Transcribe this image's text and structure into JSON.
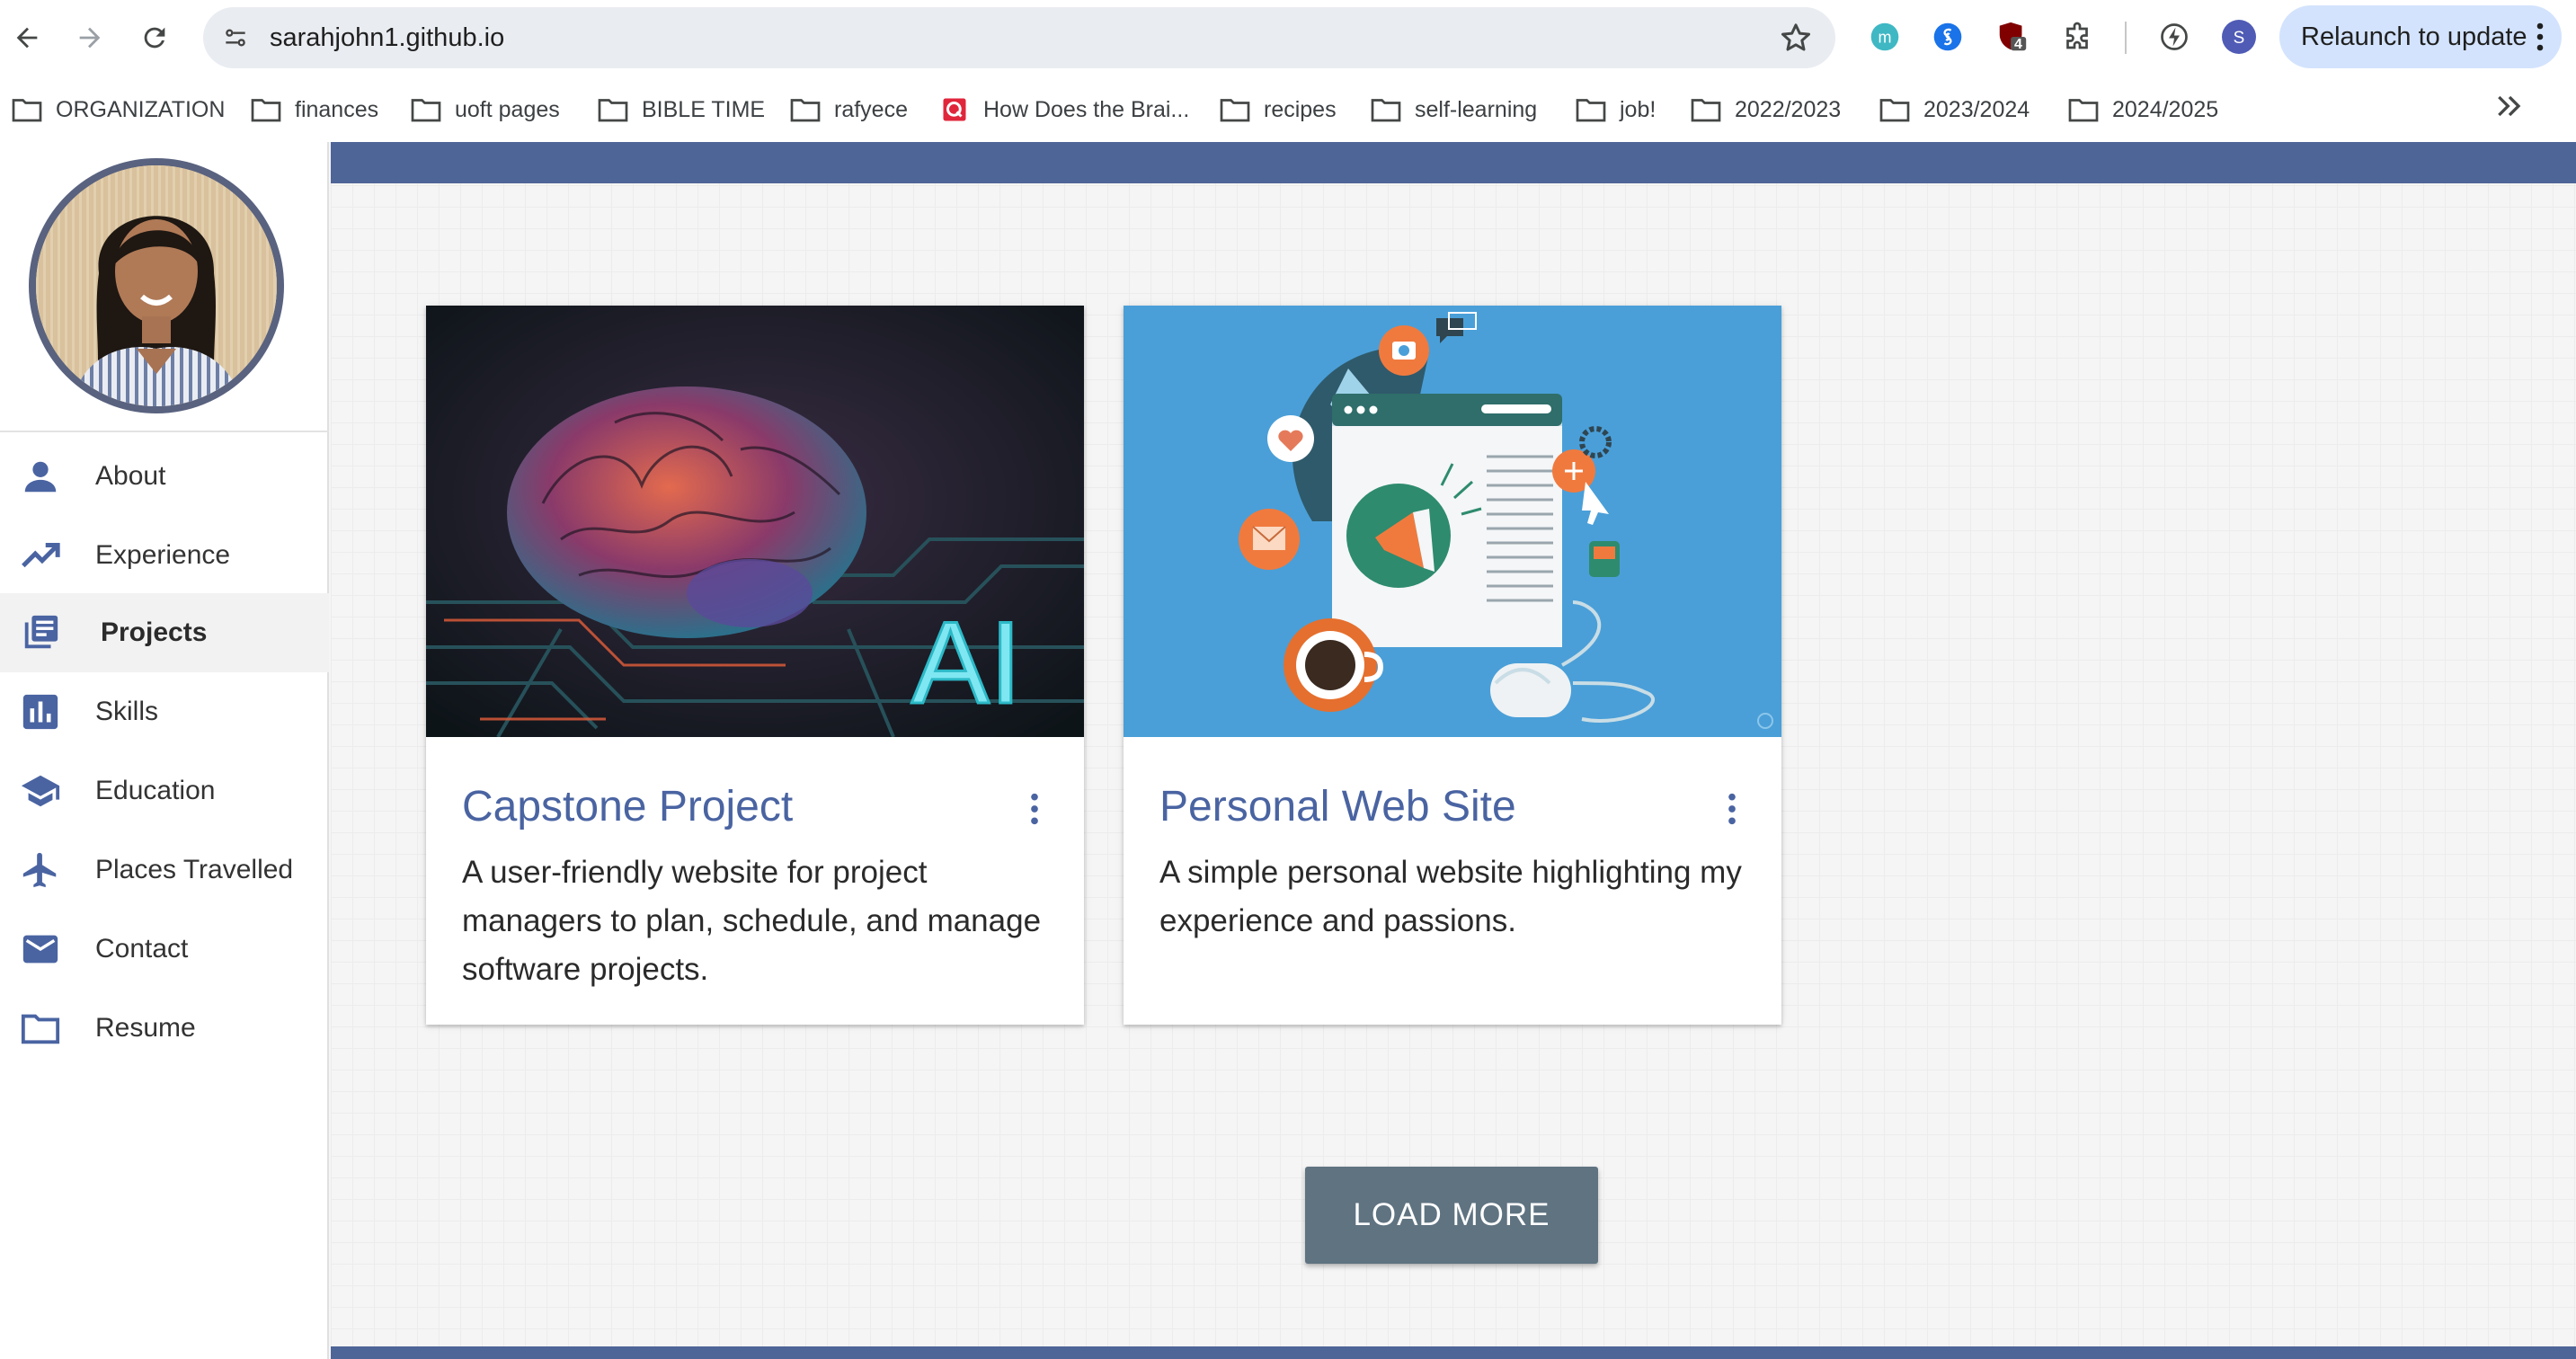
{
  "browser": {
    "url": "sarahjohn1.github.io",
    "relaunch_label": "Relaunch to update",
    "profile_initial": "S",
    "extension_badge": "4",
    "extension_m_letter": "m",
    "bookmarks": [
      {
        "label": "ORGANIZATION",
        "icon": "folder-icon"
      },
      {
        "label": "finances",
        "icon": "folder-icon"
      },
      {
        "label": "uoft pages",
        "icon": "folder-icon"
      },
      {
        "label": "BIBLE TIME",
        "icon": "folder-icon"
      },
      {
        "label": "rafyece",
        "icon": "folder-icon"
      },
      {
        "label": "How Does the Brai...",
        "icon": "quizlet-icon"
      },
      {
        "label": "recipes",
        "icon": "folder-icon"
      },
      {
        "label": "self-learning",
        "icon": "folder-icon"
      },
      {
        "label": "job!",
        "icon": "folder-icon"
      },
      {
        "label": "2022/2023",
        "icon": "folder-icon"
      },
      {
        "label": "2023/2024",
        "icon": "folder-icon"
      },
      {
        "label": "2024/2025",
        "icon": "folder-icon"
      }
    ]
  },
  "sidebar": {
    "nav": [
      {
        "label": "About",
        "icon": "person-icon"
      },
      {
        "label": "Experience",
        "icon": "trending-up-icon"
      },
      {
        "label": "Projects",
        "icon": "articles-icon",
        "active": true
      },
      {
        "label": "Skills",
        "icon": "bar-chart-icon"
      },
      {
        "label": "Education",
        "icon": "graduation-cap-icon"
      },
      {
        "label": "Places Travelled",
        "icon": "airplane-icon"
      },
      {
        "label": "Contact",
        "icon": "mail-icon"
      },
      {
        "label": "Resume",
        "icon": "folder-icon"
      }
    ]
  },
  "projects": [
    {
      "title": "Capstone Project",
      "description": "A user-friendly website for project managers to plan, schedule, and manage software projects.",
      "image_text": "AI"
    },
    {
      "title": "Personal Web Site",
      "description": "A simple personal website highlighting my experience and passions."
    }
  ],
  "load_more_label": "LOAD MORE",
  "colors": {
    "accent": "#4e6597",
    "card_title": "#4a64a2",
    "button": "#5f7381",
    "relaunch_bg": "#d3e3fd"
  }
}
